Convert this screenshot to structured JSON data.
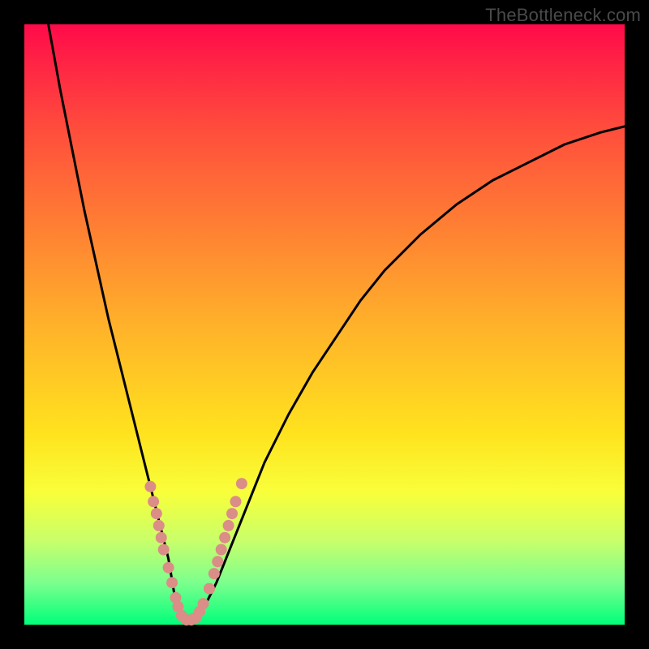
{
  "watermark": "TheBottleneck.com",
  "chart_data": {
    "type": "line",
    "title": "",
    "xlabel": "",
    "ylabel": "",
    "xlim": [
      0,
      100
    ],
    "ylim": [
      0,
      100
    ],
    "grid": false,
    "legend": false,
    "note": "V-shaped bottleneck curve. Values estimated from pixel positions; axes are unlabeled so units are percent of plot width/height (0 = left/bottom, 100 = right/top).",
    "series": [
      {
        "name": "bottleneck-curve",
        "color": "#000000",
        "x": [
          4,
          6,
          8,
          10,
          12,
          14,
          16,
          18,
          20,
          21,
          22,
          23,
          24,
          24.5,
          25,
          25.5,
          26,
          27,
          28,
          29,
          30,
          32,
          34,
          36,
          38,
          40,
          44,
          48,
          52,
          56,
          60,
          66,
          72,
          78,
          84,
          90,
          96,
          100
        ],
        "y": [
          100,
          89,
          79,
          69,
          60,
          51,
          43,
          35,
          27,
          23,
          19,
          15,
          11,
          8,
          5,
          3,
          1,
          0.5,
          0.5,
          1,
          3,
          7,
          12,
          17,
          22,
          27,
          35,
          42,
          48,
          54,
          59,
          65,
          70,
          74,
          77,
          80,
          82,
          83
        ]
      }
    ],
    "markers": {
      "name": "highlight-dots",
      "color": "#db8d87",
      "points": [
        {
          "x": 21.0,
          "y": 23.0
        },
        {
          "x": 21.5,
          "y": 20.5
        },
        {
          "x": 22.0,
          "y": 18.5
        },
        {
          "x": 22.4,
          "y": 16.5
        },
        {
          "x": 22.8,
          "y": 14.5
        },
        {
          "x": 23.2,
          "y": 12.5
        },
        {
          "x": 24.0,
          "y": 9.5
        },
        {
          "x": 24.6,
          "y": 7.0
        },
        {
          "x": 25.2,
          "y": 4.5
        },
        {
          "x": 25.6,
          "y": 3.0
        },
        {
          "x": 26.2,
          "y": 1.5
        },
        {
          "x": 27.0,
          "y": 0.8
        },
        {
          "x": 27.8,
          "y": 0.8
        },
        {
          "x": 28.6,
          "y": 1.2
        },
        {
          "x": 29.2,
          "y": 2.2
        },
        {
          "x": 29.8,
          "y": 3.5
        },
        {
          "x": 30.8,
          "y": 6.0
        },
        {
          "x": 31.6,
          "y": 8.5
        },
        {
          "x": 32.2,
          "y": 10.5
        },
        {
          "x": 32.8,
          "y": 12.5
        },
        {
          "x": 33.4,
          "y": 14.5
        },
        {
          "x": 34.0,
          "y": 16.5
        },
        {
          "x": 34.6,
          "y": 18.5
        },
        {
          "x": 35.2,
          "y": 20.5
        },
        {
          "x": 36.2,
          "y": 23.5
        }
      ]
    }
  }
}
